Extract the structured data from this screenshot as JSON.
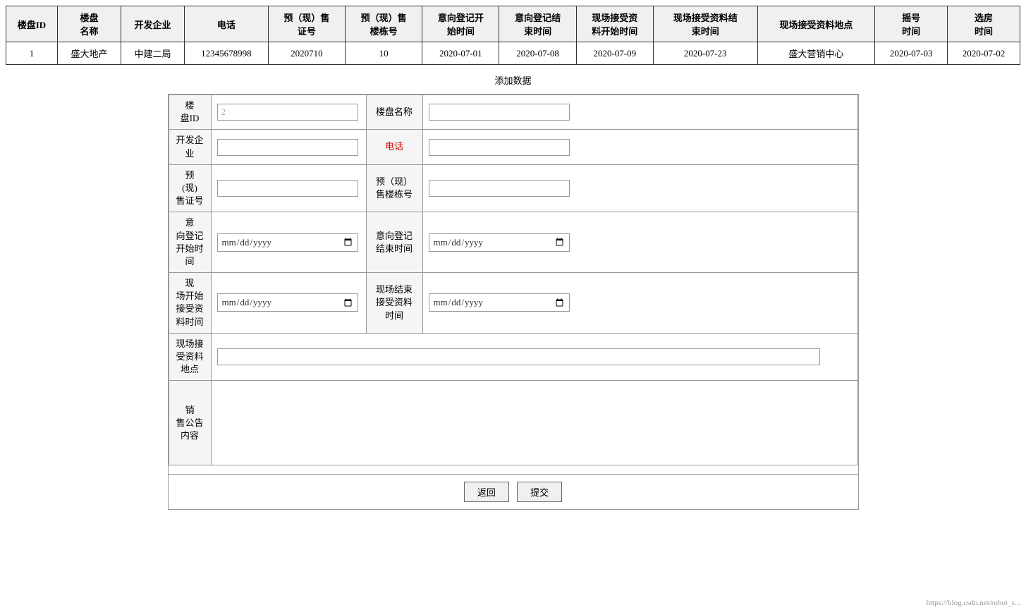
{
  "mainTable": {
    "headers": [
      "楼盘ID",
      "楼盘\n名称",
      "开发企业",
      "电话",
      "预（现）售\n证号",
      "预（现）售\n楼栋号",
      "意向登记开\n始时间",
      "意向登记结\n束时间",
      "现场接受资\n料开始时间",
      "现场接受资料结\n束时间",
      "现场接受资料地点",
      "摇号\n时间",
      "选房\n时间"
    ],
    "rows": [
      {
        "id": "1",
        "name": "盛大地产",
        "developer": "中建二局",
        "phone": "12345678998",
        "certNo": "2020710",
        "buildingNo": "10",
        "registerStart": "2020-07-01",
        "registerEnd": "2020-07-08",
        "receiveStart": "2020-07-09",
        "receiveEnd": "2020-07-23",
        "location": "盛大营销中心",
        "lotteryTime": "2020-07-03",
        "selectTime": "2020-07-02"
      }
    ]
  },
  "addDataLabel": "添加数据",
  "form": {
    "fields": {
      "loupanId": {
        "label": "楼\n盘ID",
        "placeholder": "2",
        "value": ""
      },
      "loupanName": {
        "label": "楼盘名称",
        "placeholder": "",
        "value": ""
      },
      "developer": {
        "label": "开发企\n业",
        "placeholder": "",
        "value": ""
      },
      "phone": {
        "label": "电话",
        "placeholder": "",
        "value": ""
      },
      "certNo": {
        "label": "预\n(现)\n售证号",
        "placeholder": "",
        "value": ""
      },
      "buildingNo": {
        "label": "预（现）售楼栋号",
        "placeholder": "",
        "value": ""
      },
      "registerStart": {
        "label": "意\n向登记\n开始时\n间",
        "placeholder": "年 /月/日",
        "value": ""
      },
      "registerEnd": {
        "label": "意向登记结束时间",
        "placeholder": "年 /月/日",
        "value": ""
      },
      "receiveStart": {
        "label": "现\n场开始\n接受资\n料时间",
        "placeholder": "年 /月/日",
        "value": ""
      },
      "receiveEnd": {
        "label": "现场结束接受资料时间",
        "placeholder": "年 /月/日",
        "value": ""
      },
      "location": {
        "label": "现场接\n受资料\n地点",
        "placeholder": "",
        "value": ""
      },
      "saleContent": {
        "label": "销\n售公告\n内容",
        "placeholder": "",
        "value": ""
      }
    },
    "buttons": {
      "back": "返回",
      "submit": "提交"
    }
  }
}
